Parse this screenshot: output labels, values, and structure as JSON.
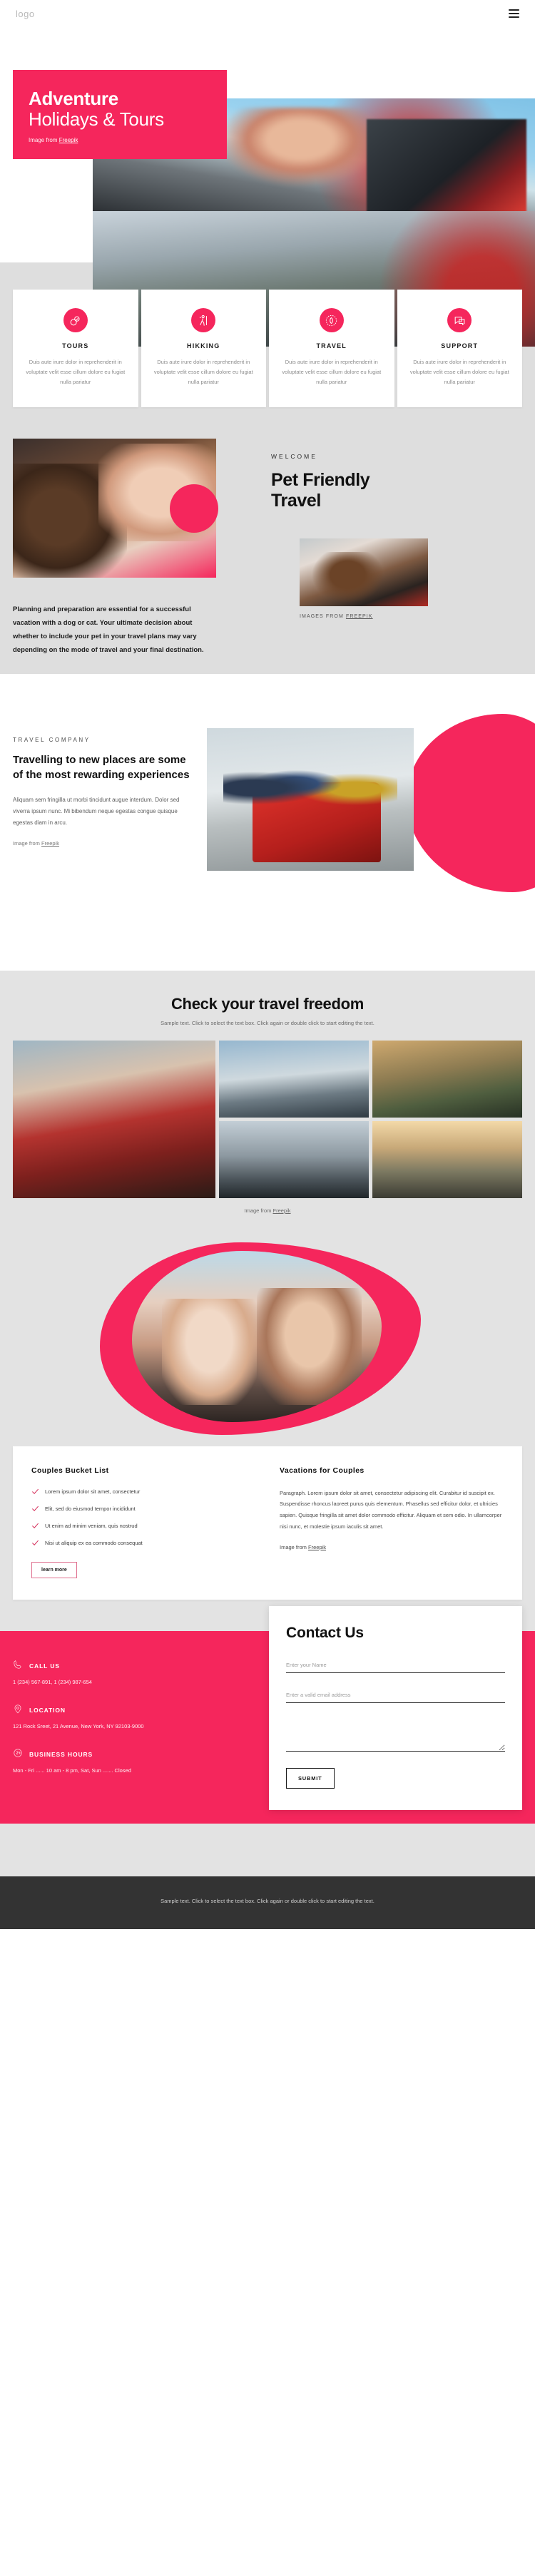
{
  "header": {
    "logo": "logo",
    "menu_label": "menu"
  },
  "hero": {
    "title_line1": "Adventure",
    "title_line2": "Holidays & Tours",
    "credit_prefix": "Image from ",
    "credit_link": "Freepik"
  },
  "features": [
    {
      "icon": "tours-icon",
      "title": "TOURS",
      "text": "Duis aute irure dolor in reprehenderit in voluptate velit esse cillum dolore eu fugiat nulla pariatur"
    },
    {
      "icon": "hiking-icon",
      "title": "HIKKING",
      "text": "Duis aute irure dolor in reprehenderit in voluptate velit esse cillum dolore eu fugiat nulla pariatur"
    },
    {
      "icon": "travel-icon",
      "title": "TRAVEL",
      "text": "Duis aute irure dolor in reprehenderit in voluptate velit esse cillum dolore eu fugiat nulla pariatur"
    },
    {
      "icon": "support-icon",
      "title": "SUPPORT",
      "text": "Duis aute irure dolor in reprehenderit in voluptate velit esse cillum dolore eu fugiat nulla pariatur"
    }
  ],
  "pet": {
    "eyebrow": "WELCOME",
    "heading_line1": "Pet Friendly",
    "heading_line2": "Travel",
    "caption_prefix": "IMAGES FROM ",
    "caption_link": "FREEPIK",
    "body": "Planning and preparation are essential for a successful vacation with a dog or cat. Your ultimate decision about whether to include your pet in your travel plans may vary depending on the mode of travel and your final destination."
  },
  "travel_company": {
    "eyebrow": "TRAVEL COMPANY",
    "heading": "Travelling to new places are some of the most rewarding experiences",
    "body": "Aliquam sem fringilla ut morbi tincidunt augue interdum. Dolor sed viverra ipsum nunc. Mi bibendum neque egestas congue quisque egestas diam in arcu.",
    "credit_prefix": "Image from ",
    "credit_link": "Freepik"
  },
  "gallery": {
    "title": "Check your travel freedom",
    "subtitle": "Sample text. Click to select the text box. Click again or double click to start editing the text.",
    "credit_prefix": "Image from ",
    "credit_link": "Freepik",
    "tiles": [
      "woman-in-red-top-portrait",
      "bridge-over-valley",
      "mountain-road-aerial",
      "person-on-pier",
      "desert-highway"
    ]
  },
  "bucket_list": {
    "title": "Couples Bucket List",
    "items": [
      "Lorem ipsum dolor sit amet, consectetur",
      "Elit, sed do eiusmod tempor incididunt",
      "Ut enim ad minim veniam, quis nostrud",
      "Nisi ut aliquip ex ea commodo consequat"
    ],
    "button_label": "learn more"
  },
  "vacations": {
    "title": "Vacations for Couples",
    "body": "Paragraph. Lorem ipsum dolor sit amet, consectetur adipiscing elit. Curabitur id suscipit ex. Suspendisse rhoncus laoreet purus quis elementum. Phasellus sed efficitur dolor, et ultricies sapien. Quisque fringilla sit amet dolor commodo efficitur. Aliquam et sem odio. In ullamcorper nisi nunc, et molestie ipsum iaculis sit amet.",
    "credit_prefix": "Image from ",
    "credit_link": "Freepik"
  },
  "contact": {
    "blocks": [
      {
        "icon": "phone-icon",
        "title": "CALL US",
        "text": "1 (234) 567-891, 1 (234) 987-654"
      },
      {
        "icon": "location-pin-icon",
        "title": "LOCATION",
        "text": "121 Rock Sreet, 21 Avenue, New York, NY 92103-9000"
      },
      {
        "icon": "clock-24-icon",
        "title": "BUSINESS HOURS",
        "text": "Mon - Fri ...... 10 am - 8 pm, Sat, Sun ....... Closed"
      }
    ],
    "form": {
      "title": "Contact Us",
      "name_placeholder": "Enter your Name",
      "name_value": "",
      "email_placeholder": "Enter a valid email address",
      "email_value": "",
      "message_placeholder": "",
      "message_value": "",
      "submit_label": "SUBMIT"
    }
  },
  "footer": {
    "text": "Sample text. Click to select the text box. Click again or double click to start editing the text."
  },
  "colors": {
    "accent": "#f5265c",
    "band_gray": "#e3e3e3",
    "footer_dark": "#333333"
  }
}
